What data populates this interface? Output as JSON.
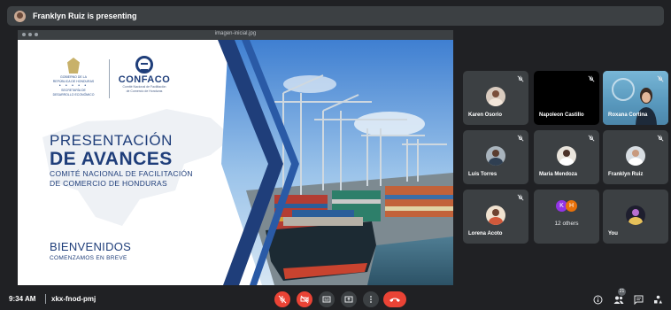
{
  "presenting_bar": {
    "text": "Franklyn Ruiz is presenting"
  },
  "slide": {
    "file_name": "imagen-inicial.jpg",
    "government_logo_lines": [
      "GOBIERNO DE LA",
      "REPÚBLICA DE HONDURAS",
      "SECRETARÍA DE",
      "DESARROLLO ECONÓMICO"
    ],
    "logo_name": "CONFACO",
    "logo_subtitle": [
      "Comité Nacional de Facilitación",
      "de Comercio de Honduras"
    ],
    "title_line1": "PRESENTACIÓN",
    "title_line2": "DE AVANCES",
    "subtitle_line1": "COMITÉ NACIONAL DE FACILITACIÓN",
    "subtitle_line2": "DE COMERCIO DE HONDURAS",
    "welcome": "BIENVENIDOS",
    "starting_soon": "COMENZAMOS EN BREVE"
  },
  "participants": [
    {
      "name": "Karen Osorio",
      "muted": true
    },
    {
      "name": "Napoleon Castillo",
      "muted": true
    },
    {
      "name": "Roxana Cortina",
      "muted": true
    },
    {
      "name": "Luis Torres",
      "muted": true
    },
    {
      "name": "Maria Mendoza",
      "muted": true
    },
    {
      "name": "Franklyn Ruiz",
      "muted": true
    },
    {
      "name": "Lorena Acoto",
      "muted": true
    },
    {
      "name": "12 others",
      "initials": [
        "K",
        "H"
      ]
    },
    {
      "name": "You"
    }
  ],
  "bottom_bar": {
    "time": "9:34 AM",
    "meeting_code": "xkx-fnod-pmj",
    "participant_count": "21"
  },
  "colors": {
    "background": "#202124",
    "tile": "#3c4043",
    "danger": "#ea4335",
    "slide_blue": "#1f3e7a"
  },
  "icons": [
    "mic-off-icon",
    "camera-off-icon",
    "captions-icon",
    "present-icon",
    "more-icon",
    "hang-up-icon",
    "info-icon",
    "people-icon",
    "chat-icon",
    "activities-icon"
  ]
}
